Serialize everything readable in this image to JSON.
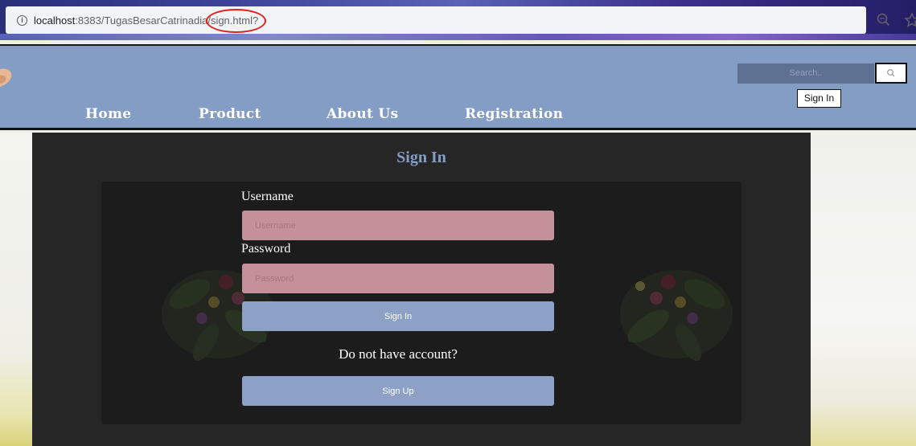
{
  "browser": {
    "url_host": "localhost",
    "url_path": ":8383/TugasBesarCatrinadia/",
    "url_file": "sign.html?"
  },
  "header": {
    "search_placeholder": "Search..",
    "signin_label": "Sign In",
    "nav": [
      {
        "label": "Home"
      },
      {
        "label": "Product"
      },
      {
        "label": "About Us"
      },
      {
        "label": "Registration"
      }
    ]
  },
  "page": {
    "title": "Sign In",
    "username_label": "Username",
    "username_placeholder": "Username",
    "password_label": "Password",
    "password_placeholder": "Password",
    "signin_button": "Sign In",
    "no_account_text": "Do not have account?",
    "signup_button": "Sign Up"
  },
  "colors": {
    "header_bg": "#849dc4",
    "panel_bg": "#262626",
    "input_bg": "#c49099",
    "button_bg": "#8da0c5",
    "title_color": "#849dc4"
  },
  "icons": [
    "info-icon",
    "zoom-icon",
    "star-icon",
    "search-icon"
  ]
}
